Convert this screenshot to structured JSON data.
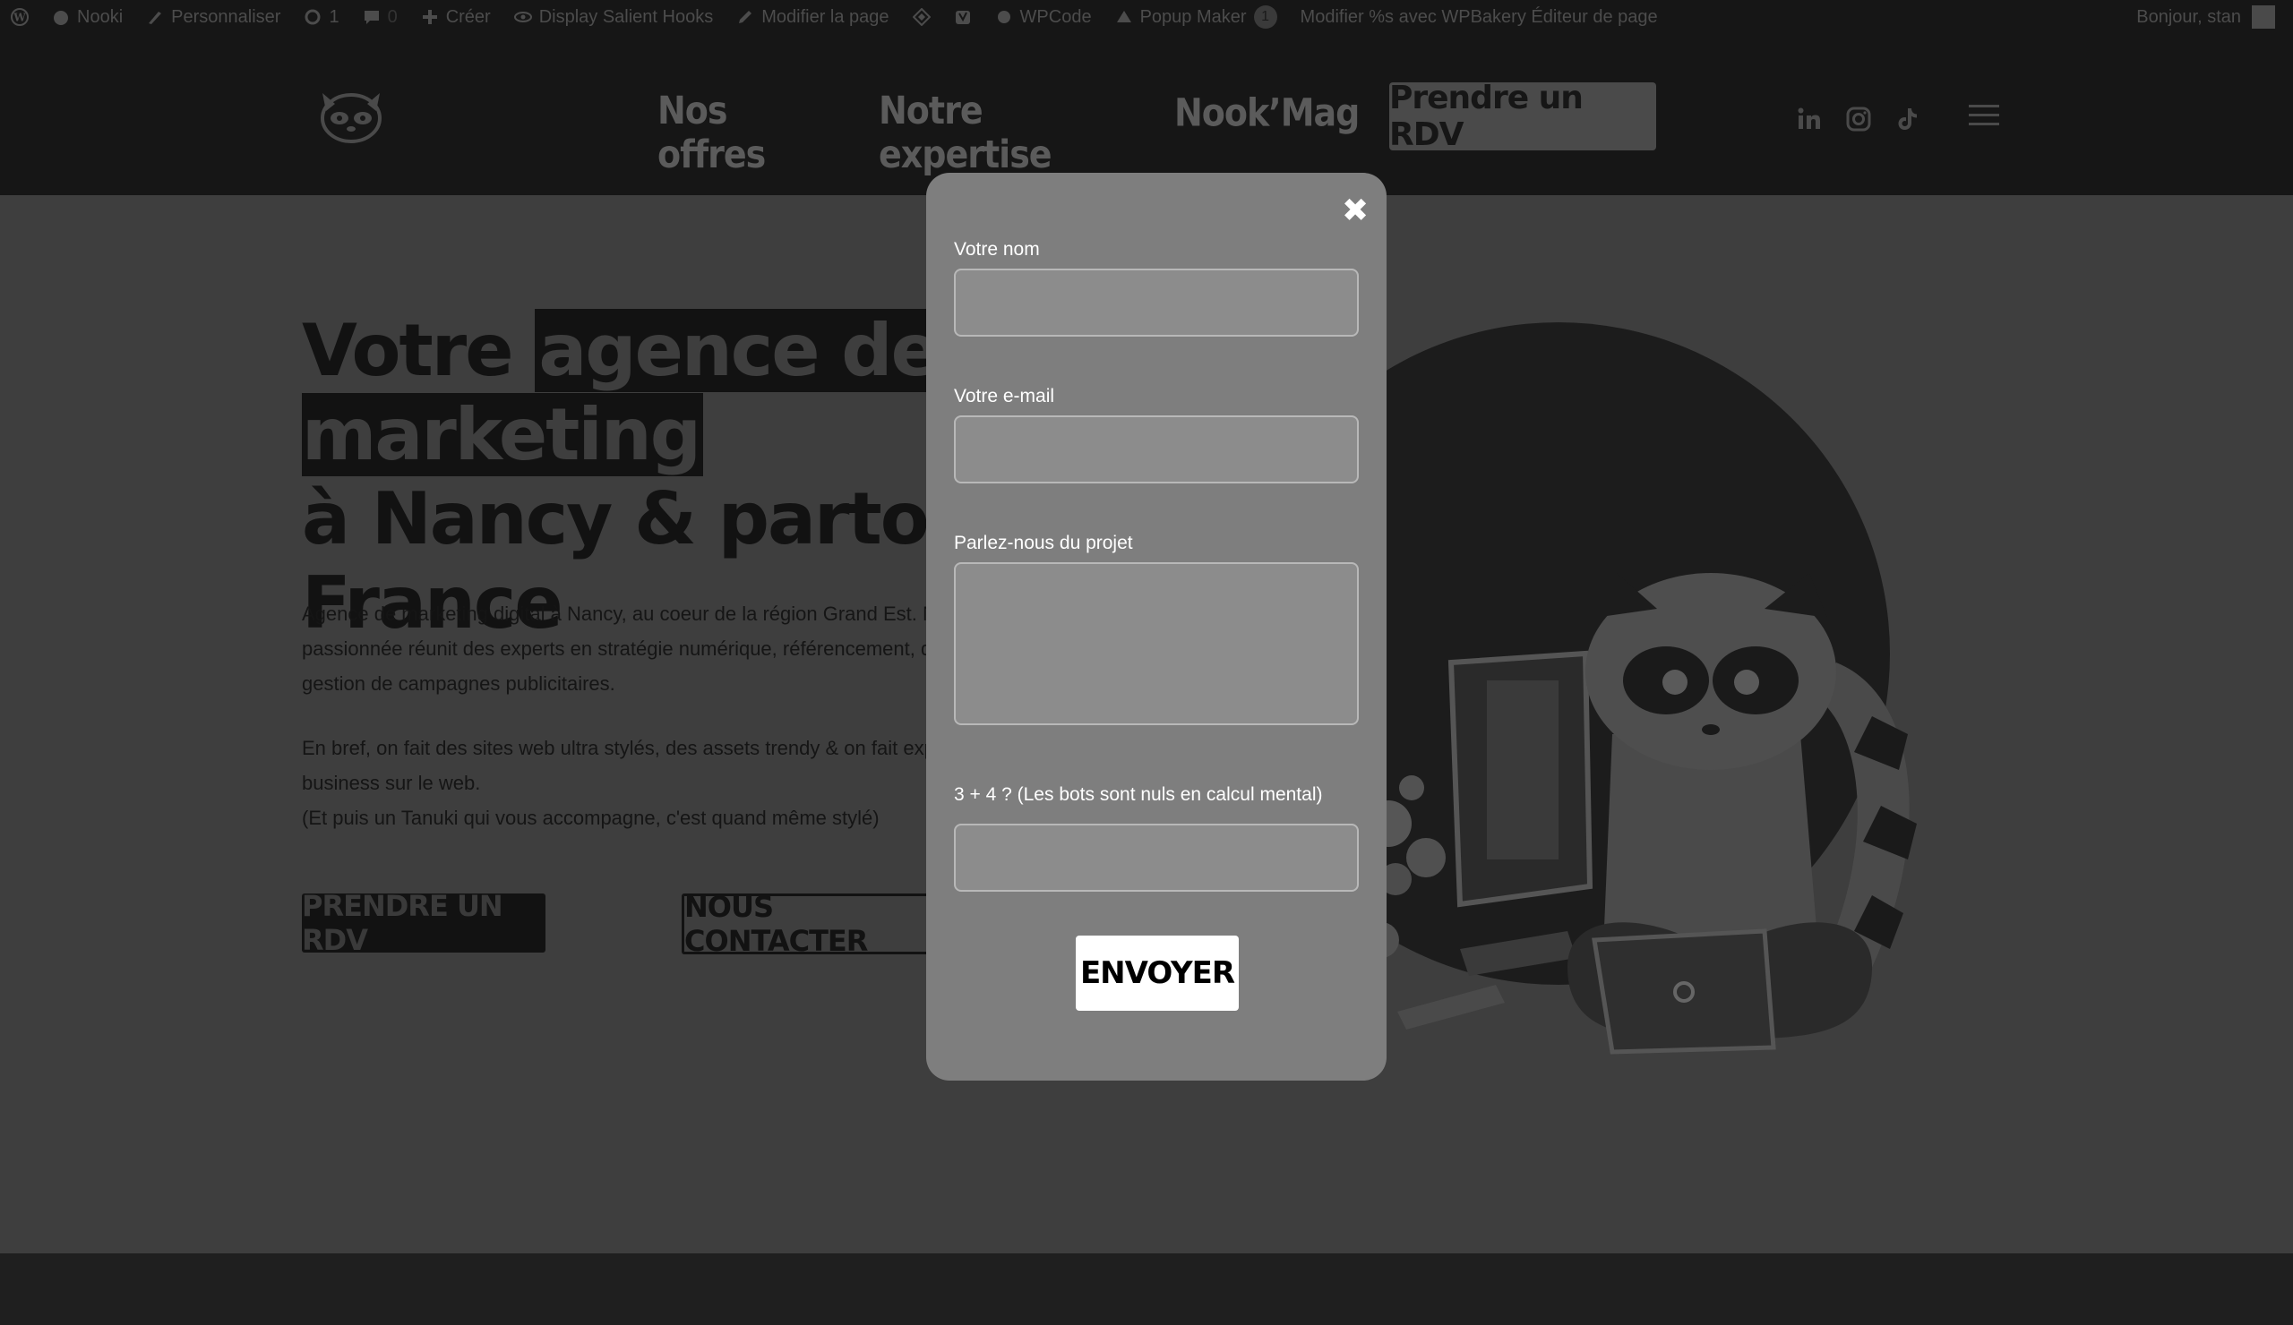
{
  "adminbar": {
    "items": [
      {
        "icon": "wordpress-icon",
        "label": ""
      },
      {
        "icon": "home-icon",
        "label": "Nooki"
      },
      {
        "icon": "brush-icon",
        "label": "Personnaliser"
      },
      {
        "icon": "refresh-icon",
        "label": "1"
      },
      {
        "icon": "comment-icon",
        "label": "0"
      },
      {
        "icon": "plus-icon",
        "label": "Créer"
      },
      {
        "icon": "eye-icon",
        "label": "Display Salient Hooks"
      },
      {
        "icon": "pencil-icon",
        "label": "Modifier la page"
      },
      {
        "icon": "diamond-icon",
        "label": ""
      },
      {
        "icon": "yoast-icon",
        "label": ""
      },
      {
        "icon": "circle-icon",
        "label": "WPCode"
      },
      {
        "icon": "popup-icon",
        "label": "Popup Maker",
        "badge": "1"
      },
      {
        "icon": "",
        "label": "Modifier %s avec WPBakery Éditeur de page"
      }
    ],
    "greeting": "Bonjour, stan"
  },
  "nav": {
    "offres": "Nos offres",
    "expertise": "Notre expertise",
    "mag": "Nook’Mag",
    "cta": "Prendre un RDV"
  },
  "hero": {
    "title_1": "Votre ",
    "title_highlight": "agence de marketing",
    "title_2": "à Nancy & partout en",
    "title_3": "France",
    "p1_line1": "Agence de marketing digital à Nancy, au coeur de la région Grand Est. Nooki, agence",
    "p1_line2": "passionnée réunit des experts en stratégie numérique, référencement, design et",
    "p1_line3": "gestion de campagnes publicitaires.",
    "p2_line1": "En bref, on fait des sites web ultra stylés, des assets trendy & on fait exploser votre",
    "p2_line2": "business sur le web.",
    "p2_line3": "(Et puis un Tanuki qui vous accompagne, c'est quand même stylé)",
    "btn_rdv": "PRENDRE UN RDV",
    "btn_contact": "NOUS CONTACTER"
  },
  "popup": {
    "close": "✖",
    "name_label": "Votre nom",
    "name_value": "",
    "email_label": "Votre e-mail",
    "email_value": "",
    "project_label": "Parlez-nous du projet",
    "project_value": "",
    "captcha_label": "3 + 4 ? (Les bots sont nuls en calcul mental)",
    "captcha_value": "",
    "submit": "ENVOYER"
  },
  "colors": {
    "adminbar_bg": "#161616",
    "overlay_bg": "#3e3e3e",
    "popup_bg": "#7e7e7e",
    "submit_bg": "#ffffff"
  }
}
